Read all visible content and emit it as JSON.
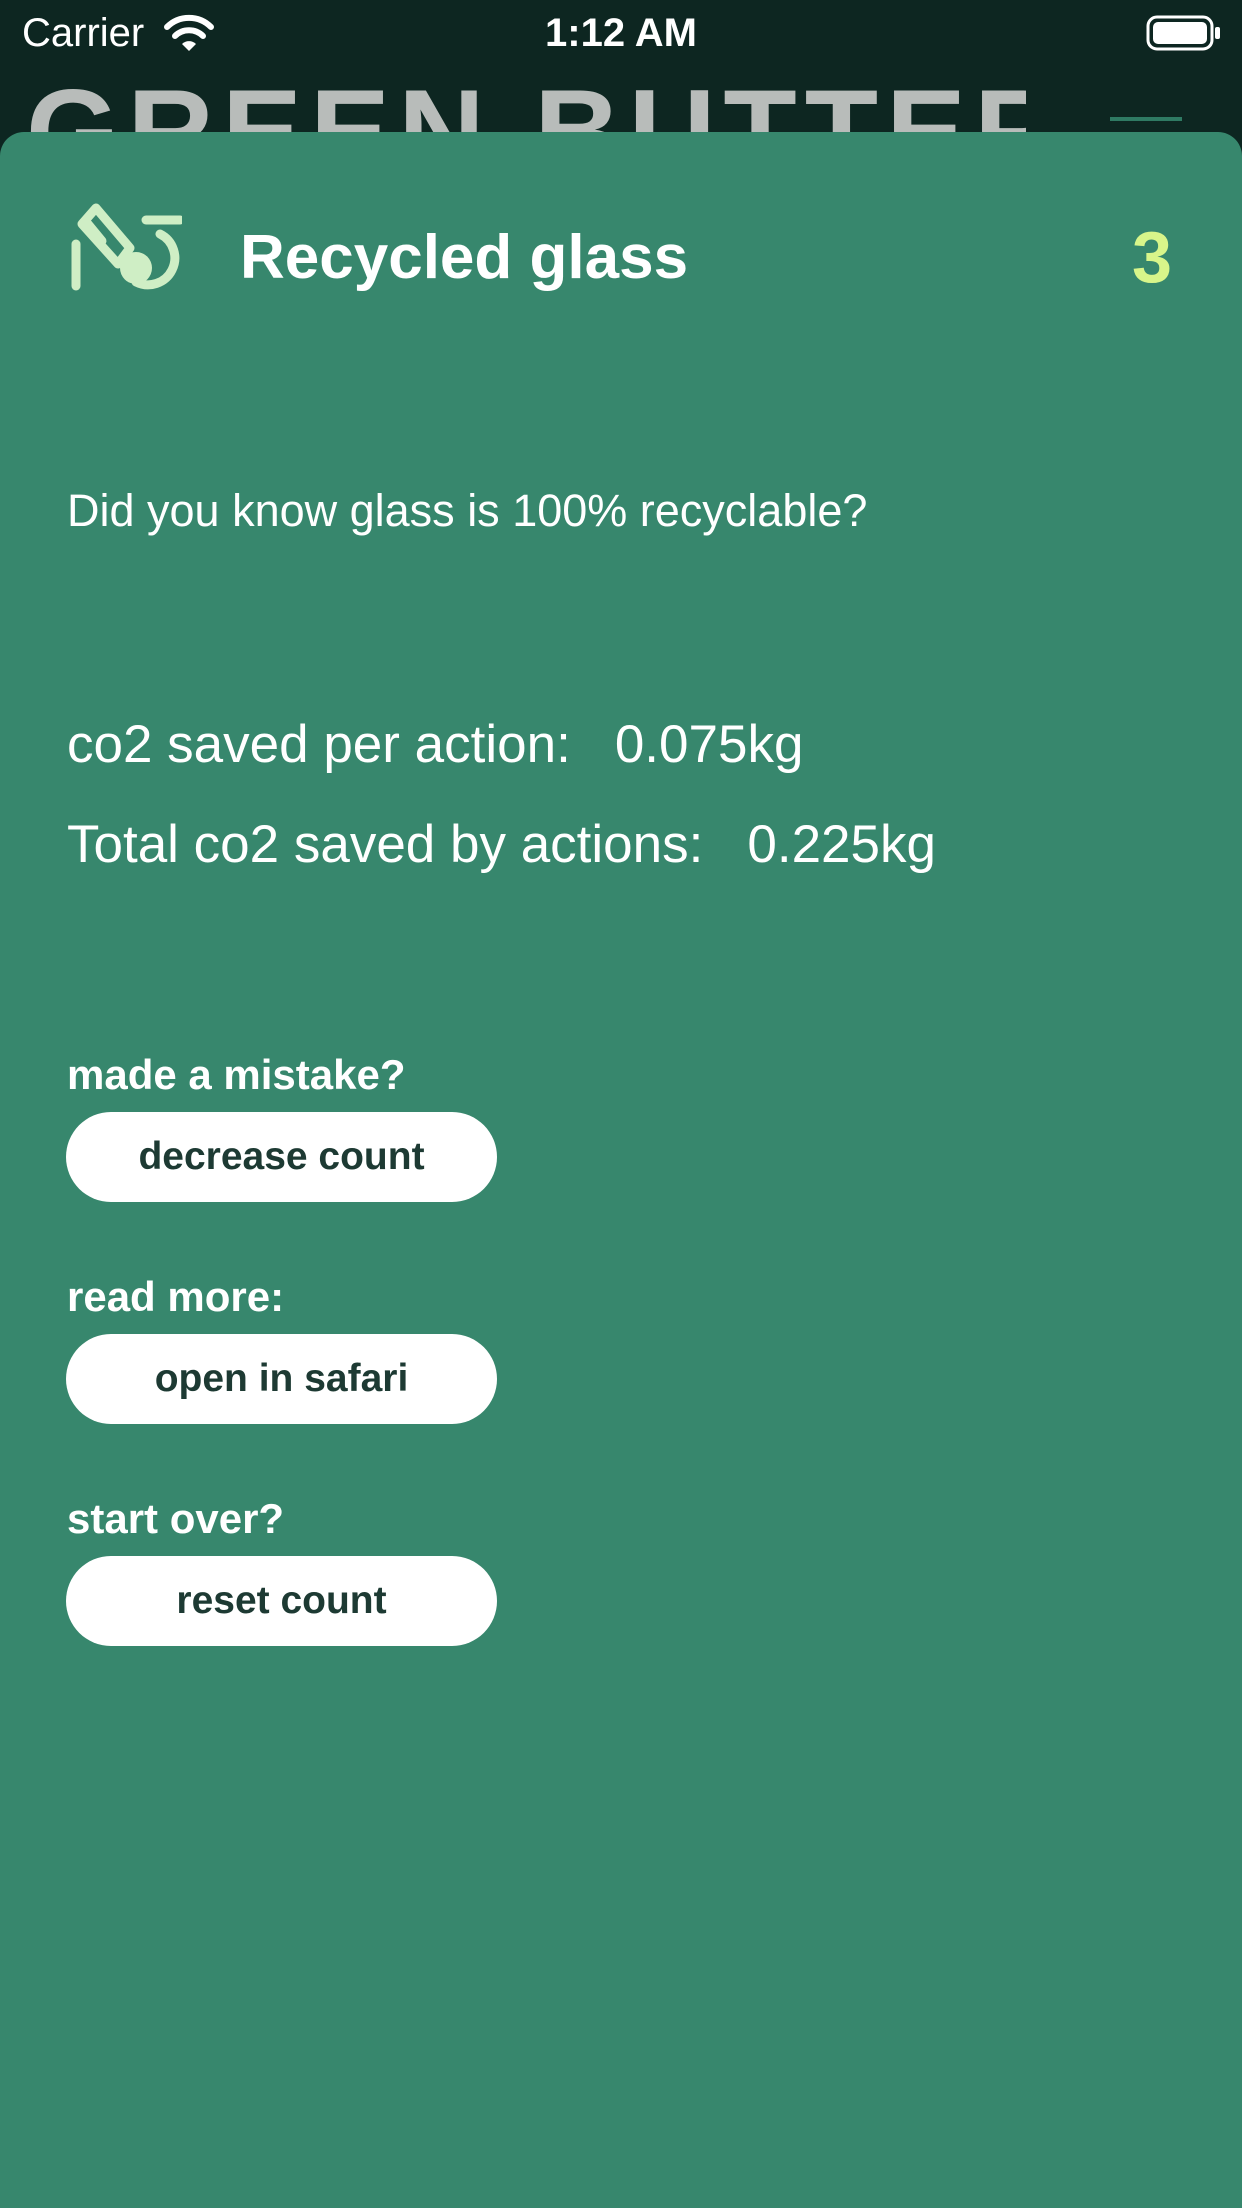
{
  "status_bar": {
    "carrier": "Carrier",
    "time": "1:12 AM",
    "wifi_icon": "wifi-icon",
    "battery_icon": "battery-icon"
  },
  "background": {
    "app_title": "GREEN BUTTERFLY",
    "menu_icon": "menu-icon"
  },
  "card": {
    "icon": "recycled-glass-icon",
    "title": "Recycled glass",
    "count": "3",
    "fact": "Did you know glass is 100% recyclable?",
    "co2_per_action_label": "co2 saved per action:",
    "co2_per_action_value": "0.075kg",
    "co2_total_label": "Total co2 saved by actions:",
    "co2_total_value": "0.225kg"
  },
  "actions": {
    "mistake_prompt": "made a mistake?",
    "decrease_label": "decrease count",
    "read_more_prompt": "read more:",
    "safari_label": "open in safari",
    "start_over_prompt": "start over?",
    "reset_label": "reset count"
  },
  "colors": {
    "sheet_background": "#37876d",
    "app_background": "#0d2621",
    "count_accent": "#d8f58a",
    "icon_tint": "#cfeec5",
    "button_text": "#1d3a33"
  }
}
